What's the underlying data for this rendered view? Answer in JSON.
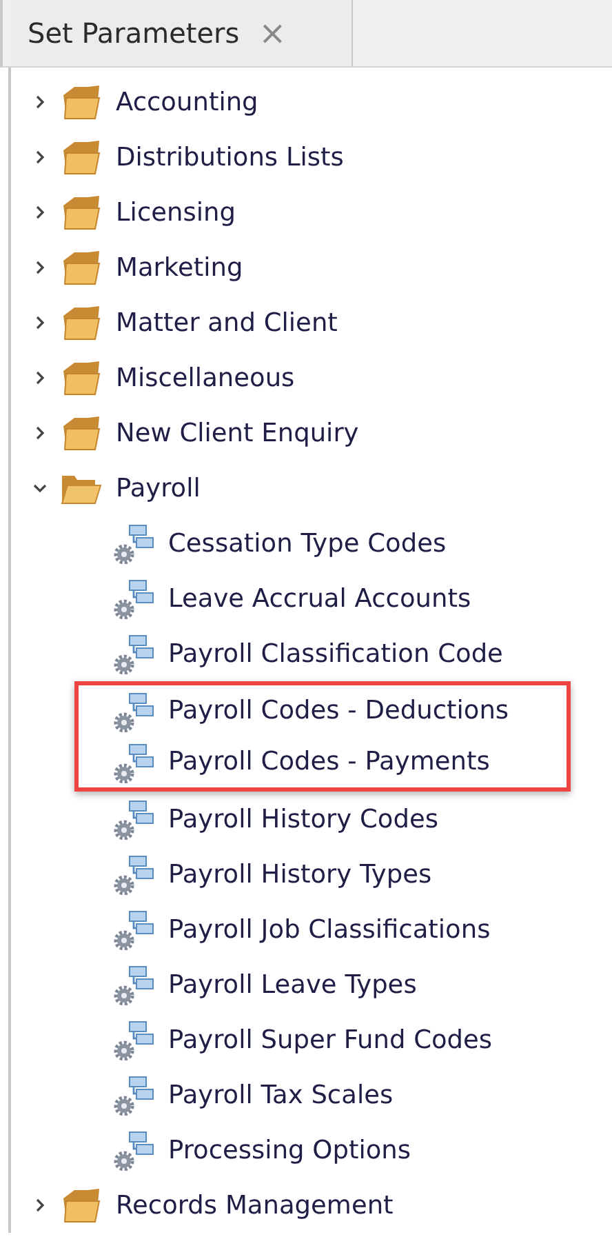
{
  "tab": {
    "title": "Set Parameters",
    "close": "×"
  },
  "tree": [
    {
      "kind": "folder",
      "label": "Accounting",
      "expanded": false
    },
    {
      "kind": "folder",
      "label": "Distributions Lists",
      "expanded": false
    },
    {
      "kind": "folder",
      "label": "Licensing",
      "expanded": false
    },
    {
      "kind": "folder",
      "label": "Marketing",
      "expanded": false
    },
    {
      "kind": "folder",
      "label": "Matter and Client",
      "expanded": false
    },
    {
      "kind": "folder",
      "label": "Miscellaneous",
      "expanded": false
    },
    {
      "kind": "folder",
      "label": "New Client Enquiry",
      "expanded": false
    },
    {
      "kind": "folder",
      "label": "Payroll",
      "expanded": true,
      "children": [
        {
          "kind": "table",
          "label": "Cessation Type Codes",
          "highlighted": false
        },
        {
          "kind": "table",
          "label": "Leave Accrual Accounts",
          "highlighted": false
        },
        {
          "kind": "table",
          "label": "Payroll Classification Code",
          "highlighted": false
        },
        {
          "kind": "table",
          "label": "Payroll Codes - Deductions",
          "highlighted": true
        },
        {
          "kind": "table",
          "label": "Payroll Codes - Payments",
          "highlighted": true
        },
        {
          "kind": "table",
          "label": "Payroll History Codes",
          "highlighted": false
        },
        {
          "kind": "table",
          "label": "Payroll History Types",
          "highlighted": false
        },
        {
          "kind": "table",
          "label": "Payroll Job Classifications",
          "highlighted": false
        },
        {
          "kind": "table",
          "label": "Payroll Leave Types",
          "highlighted": false
        },
        {
          "kind": "table",
          "label": "Payroll Super Fund Codes",
          "highlighted": false
        },
        {
          "kind": "table",
          "label": "Payroll Tax Scales",
          "highlighted": false
        },
        {
          "kind": "table",
          "label": "Processing Options",
          "highlighted": false
        }
      ]
    },
    {
      "kind": "folder",
      "label": "Records Management",
      "expanded": false
    }
  ]
}
